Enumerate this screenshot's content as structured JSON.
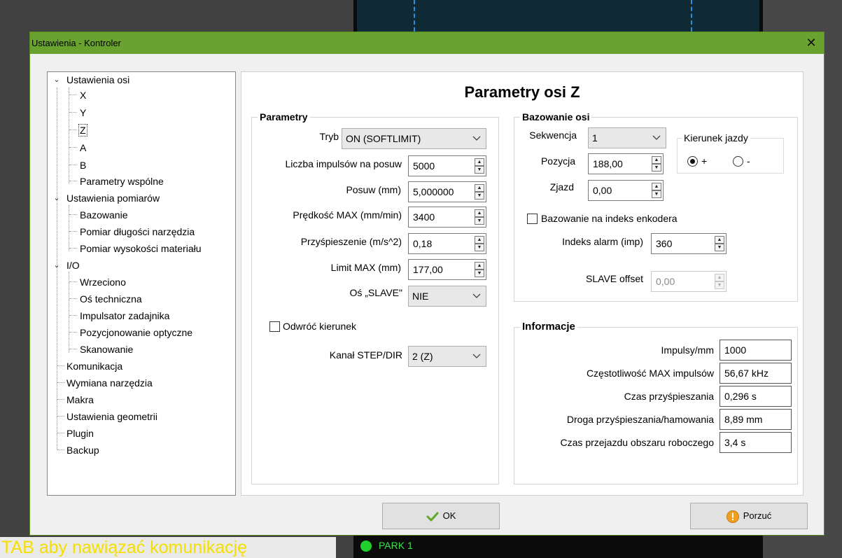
{
  "background": {
    "status_message": "TAB aby nawiązać komunikację",
    "park_label": "PARK 1"
  },
  "window": {
    "title": "Ustawienia - Kontroler",
    "close_glyph": "✕"
  },
  "tree": {
    "expand_glyph": "⌄",
    "items": {
      "ustawienia_osi": "Ustawienia osi",
      "x": "X",
      "y": "Y",
      "z": "Z",
      "a": "A",
      "b": "B",
      "parametry_wspolne": "Parametry wspólne",
      "ustawienia_pomiarow": "Ustawienia pomiarów",
      "bazowanie": "Bazowanie",
      "pomiar_dlugosci": "Pomiar długości narzędzia",
      "pomiar_wysokosci": "Pomiar wysokości materiału",
      "io": "I/O",
      "wrzeciono": "Wrzeciono",
      "os_techniczna": "Oś techniczna",
      "impulsator": "Impulsator zadajnika",
      "pozycjonowanie": "Pozycjonowanie optyczne",
      "skanowanie": "Skanowanie",
      "komunikacja": "Komunikacja",
      "wymiana": "Wymiana narzędzia",
      "makra": "Makra",
      "geometria": "Ustawienia geometrii",
      "plugin": "Plugin",
      "backup": "Backup"
    },
    "selected": "Z"
  },
  "page": {
    "title": "Parametry osi Z"
  },
  "parametry": {
    "title": "Parametry",
    "tryb_label": "Tryb",
    "tryb_value": "ON (SOFTLIMIT)",
    "impulsy_label": "Liczba impulsów na posuw",
    "impulsy_value": "5000",
    "posuw_label": "Posuw (mm)",
    "posuw_value": "5,000000",
    "predkosc_label": "Prędkość MAX (mm/min)",
    "predkosc_value": "3400",
    "przysp_label": "Przyśpieszenie (m/s^2)",
    "przysp_value": "0,18",
    "limit_label": "Limit MAX (mm)",
    "limit_value": "177,00",
    "slave_label": "Oś „SLAVE\"",
    "slave_value": "NIE",
    "odwroc_label": "Odwróć kierunek",
    "odwroc_checked": false,
    "kanal_label": "Kanał STEP/DIR",
    "kanal_value": "2 (Z)"
  },
  "bazowanie": {
    "title": "Bazowanie osi",
    "sekwencja_label": "Sekwencja",
    "sekwencja_value": "1",
    "pozycja_label": "Pozycja",
    "pozycja_value": "188,00",
    "zjazd_label": "Zjazd",
    "zjazd_value": "0,00",
    "kierunek_title": "Kierunek jazdy",
    "kierunek_plus": "+",
    "kierunek_minus": "-",
    "kierunek_selected": "+",
    "enkoder_label": "Bazowanie na indeks enkodera",
    "enkoder_checked": false,
    "alarm_label": "Indeks alarm (imp)",
    "alarm_value": "360",
    "slave_offset_label": "SLAVE offset",
    "slave_offset_value": "0,00"
  },
  "informacje": {
    "title": "Informacje",
    "rows": [
      {
        "label": "Impulsy/mm",
        "value": "1000"
      },
      {
        "label": "Częstotliwość MAX impulsów",
        "value": "56,67 kHz"
      },
      {
        "label": "Czas przyśpieszania",
        "value": "0,296 s"
      },
      {
        "label": "Droga przyśpieszania/hamowania",
        "value": "8,89 mm"
      },
      {
        "label": "Czas przejazdu obszaru roboczego",
        "value": "3,4 s"
      }
    ]
  },
  "buttons": {
    "ok": "OK",
    "cancel": "Porzuć"
  },
  "colors": {
    "titlebar": "#6aa22f",
    "ok_check": "#5fa82a",
    "cancel_icon": "#f0a020",
    "park": "#3ee04a",
    "status_text": "#f4e000"
  }
}
